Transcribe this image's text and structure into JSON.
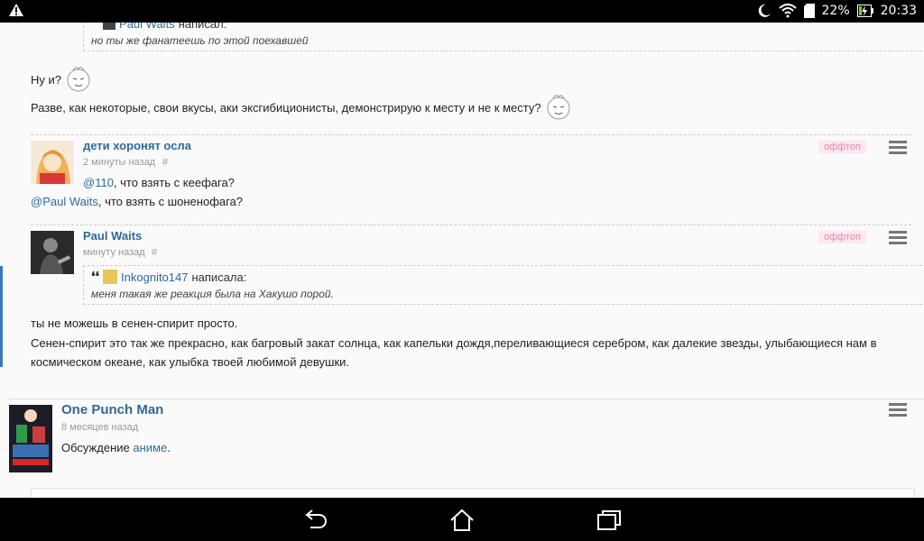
{
  "status": {
    "battery": "22%",
    "time": "20:33"
  },
  "thread": {
    "top_quote": {
      "author": "Paul Waits",
      "verb": "написал:",
      "text": "но ты же фанатеешь по этой поехавшей"
    },
    "reply1": "Ну и?",
    "reply2": "Разве, как некоторые, свои вкусы, аки эксгибиционисты, демонстрирую к месту и не к месту?",
    "comment1": {
      "author": "дети хоронят осла",
      "time": "2 минуты назад",
      "hash": "#",
      "badge": "оффтоп",
      "mention1": "@110",
      "line1": ", что взять с кеефага?",
      "mention2": "@Paul Waits",
      "line2": ", что взять с шоненофага?"
    },
    "comment2": {
      "author": "Paul Waits",
      "time": "минуту назад",
      "hash": "#",
      "badge": "оффтоп",
      "quote_author": "Inkognito147",
      "quote_verb": "написала:",
      "quote_text": "меня такая же реакция была на Хакушо порой.",
      "line1": "ты не можешь в сенен-спирит просто.",
      "line2": "Сенен-спирит это так же прекрасно, как багровый закат солнца, как капельки дождя,переливающиеся серебром, как далекие звезды, улыбающиеся нам в",
      "line3": "космическом океане, как улыбка твоей любимой девушки."
    },
    "comment3": {
      "author": "One Punch Man",
      "time": "8 месяцев назад",
      "text_prefix": "Обсуждение ",
      "link": "аниме",
      "text_suffix": "."
    }
  }
}
